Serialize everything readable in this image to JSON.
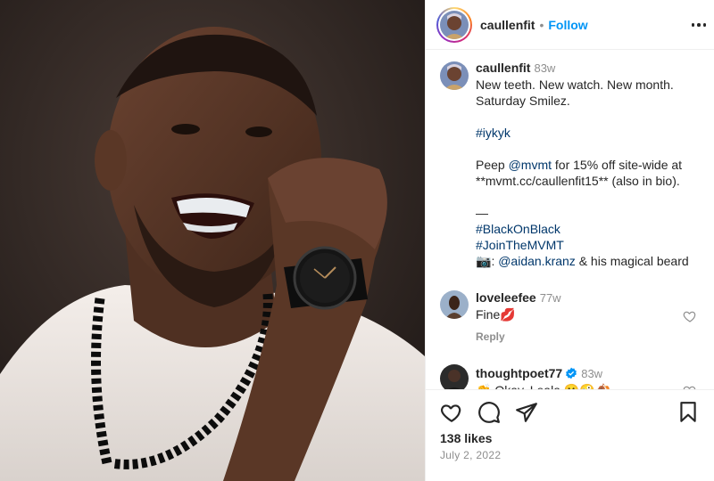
{
  "post": {
    "username": "caullenfit",
    "dot": "•",
    "follow_label": "Follow"
  },
  "caption": {
    "username": "caullenfit",
    "age": "83w",
    "line1": "New teeth. New watch. New month.",
    "line2": "Saturday Smilez.",
    "hashtag1": "#iykyk",
    "peep_pre": "Peep ",
    "peep_mention": "@mvmt",
    "peep_post": " for 15% off site-wide at",
    "url_line": "**mvmt.cc/caullenfit15** (also in bio).",
    "dash": "—",
    "hashtag2": "#BlackOnBlack",
    "hashtag3": "#JoinTheMVMT",
    "camera_emoji": "📷",
    "credit_colon": ": ",
    "credit_mention": "@aidan.kranz",
    "credit_post": " & his magical beard"
  },
  "comments": [
    {
      "username": "loveleefee",
      "age": "77w",
      "text": "Fine",
      "emoji": "💋",
      "reply_label": "Reply"
    },
    {
      "username": "thoughtpoet77",
      "age": "83w",
      "text": "👏 Okay, Leala 😬🤪🍂"
    }
  ],
  "footer": {
    "likes": "138 likes",
    "date": "July 2, 2022"
  },
  "icons": {
    "heart": "heart-icon",
    "comment": "comment-icon",
    "share": "share-icon",
    "bookmark": "bookmark-icon",
    "more": "more-options-icon",
    "verified": "verified-badge-icon"
  },
  "colors": {
    "follow": "#0095f6",
    "link": "#00376b",
    "muted": "#8e8e8e",
    "verified": "#0095f6"
  }
}
